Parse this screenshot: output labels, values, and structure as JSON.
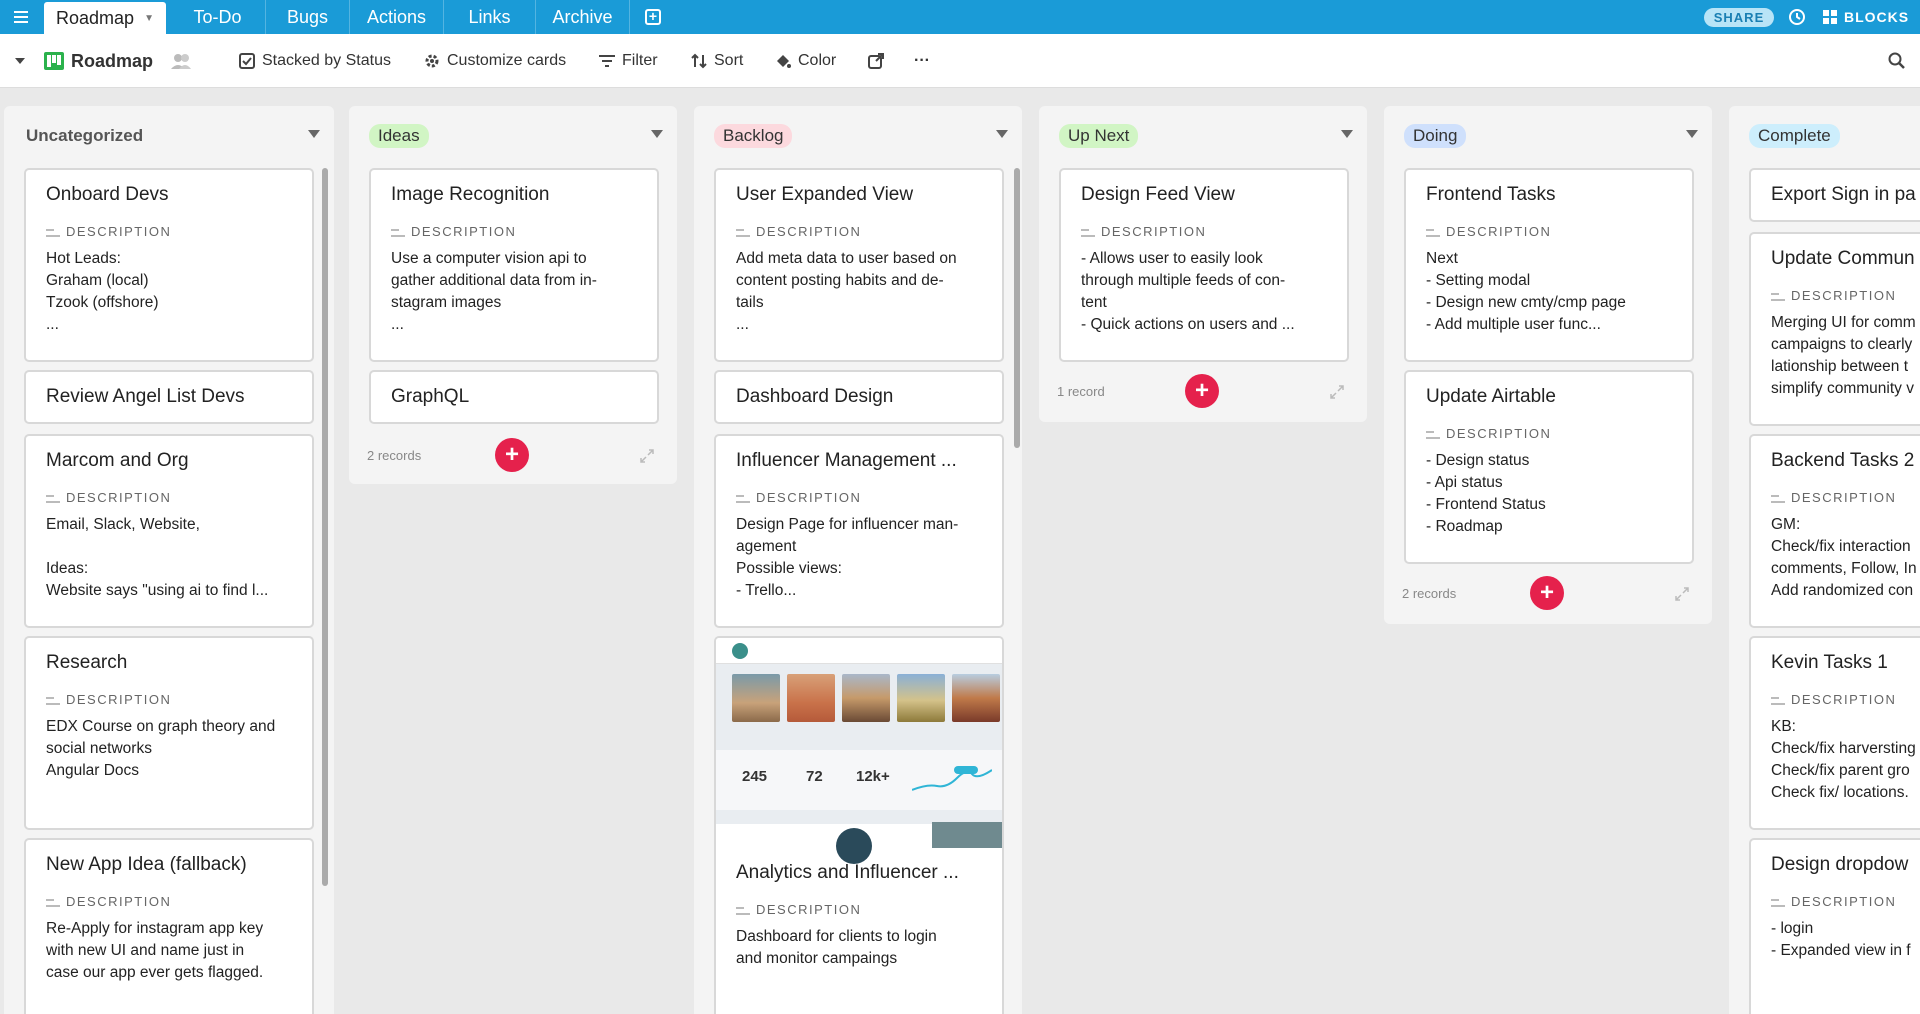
{
  "topbar": {
    "active_tab": "Roadmap",
    "tabs": [
      "To-Do",
      "Bugs",
      "Actions",
      "Links",
      "Archive"
    ],
    "share_label": "SHARE",
    "blocks_label": "BLOCKS"
  },
  "toolbar": {
    "view_name": "Roadmap",
    "stacked_label": "Stacked by Status",
    "customize_label": "Customize cards",
    "filter_label": "Filter",
    "sort_label": "Sort",
    "color_label": "Color",
    "more_label": "···"
  },
  "columns": [
    {
      "title": "Uncategorized",
      "cards": [
        {
          "title": "Onboard Devs",
          "desc_label": "DESCRIPTION",
          "desc": "Hot Leads:\nGraham (local)\nTzook (offshore)\n..."
        },
        {
          "title": "Review Angel List Devs"
        },
        {
          "title": "Marcom and Org",
          "desc_label": "DESCRIPTION",
          "desc": "Email, Slack, Website,\n\nIdeas:\nWebsite says \"using ai to find l..."
        },
        {
          "title": "Research",
          "desc_label": "DESCRIPTION",
          "desc": "EDX Course on graph theory and\nsocial networks\nAngular Docs"
        },
        {
          "title": "New App Idea (fallback)",
          "desc_label": "DESCRIPTION",
          "desc": "Re-Apply for instagram app key\nwith new UI and name just in\ncase our app ever gets flagged."
        }
      ]
    },
    {
      "title": "Ideas",
      "color": "#d1f5c4",
      "cards": [
        {
          "title": "Image Recognition",
          "desc_label": "DESCRIPTION",
          "desc": "Use a computer vision api to\ngather additional data from in-\nstagram images\n..."
        },
        {
          "title": "GraphQL"
        }
      ],
      "records": "2 records"
    },
    {
      "title": "Backlog",
      "color": "#fcd9de",
      "cards": [
        {
          "title": "User Expanded View",
          "desc_label": "DESCRIPTION",
          "desc": "Add meta data to user based on\ncontent posting habits and de-\ntails\n..."
        },
        {
          "title": "Dashboard Design"
        },
        {
          "title": "Influencer Management ...",
          "desc_label": "DESCRIPTION",
          "desc": "Design Page for influencer man-\nagement\nPossible views:\n- Trello..."
        },
        {
          "title": "Analytics and Influencer ...",
          "desc_label": "DESCRIPTION",
          "desc": "Dashboard for clients to login\nand monitor campaings",
          "preview_stats": [
            "245",
            "72",
            "12k+"
          ]
        }
      ]
    },
    {
      "title": "Up Next",
      "color": "#d1f5c4",
      "cards": [
        {
          "title": "Design Feed View",
          "desc_label": "DESCRIPTION",
          "desc": "- Allows user to easily look\nthrough multiple feeds of con-\ntent\n- Quick actions on users and ..."
        }
      ],
      "records": "1 record"
    },
    {
      "title": "Doing",
      "color": "#cfe0fc",
      "cards": [
        {
          "title": "Frontend Tasks",
          "desc_label": "DESCRIPTION",
          "desc": "Next\n- Setting modal\n- Design new cmty/cmp page\n- Add multiple user func..."
        },
        {
          "title": "Update Airtable",
          "desc_label": "DESCRIPTION",
          "desc": "- Design status\n- Api status\n- Frontend Status\n- Roadmap"
        }
      ],
      "records": "2 records"
    },
    {
      "title": "Complete",
      "color": "#cdeefc",
      "cards": [
        {
          "title": "Export Sign in pa"
        },
        {
          "title": "Update Commun",
          "desc_label": "DESCRIPTION",
          "desc": "Merging UI for comm\ncampaigns to clearly\nlationship between t\nsimplify community v"
        },
        {
          "title": "Backend Tasks 2",
          "desc_label": "DESCRIPTION",
          "desc": "GM:\nCheck/fix interaction\ncomments, Follow, In\nAdd randomized con"
        },
        {
          "title": "Kevin Tasks 1",
          "desc_label": "DESCRIPTION",
          "desc": "KB:\nCheck/fix harversting\nCheck/fix parent gro\nCheck fix/ locations."
        },
        {
          "title": "Design dropdow",
          "desc_label": "DESCRIPTION",
          "desc": "- login\n- Expanded view in f"
        }
      ]
    }
  ],
  "colors": {
    "topbar": "#1a9bd7",
    "add_record": "#e5214c",
    "view_icon": "#2bb24c"
  }
}
